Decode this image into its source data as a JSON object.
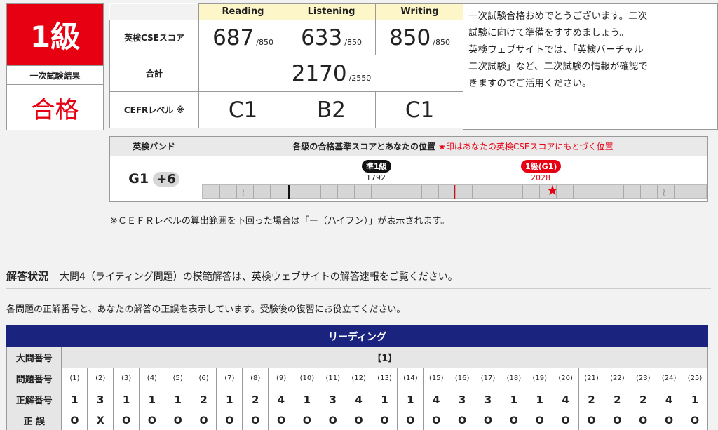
{
  "grade": {
    "level": "1級",
    "result_label": "一次試験結果",
    "result": "合格"
  },
  "scores": {
    "skills": [
      "Reading",
      "Listening",
      "Writing"
    ],
    "cse_label": "英検CSEスコア",
    "cse_values": [
      "687",
      "633",
      "850"
    ],
    "cse_max": [
      "/850",
      "/850",
      "/850"
    ],
    "total_label": "合計",
    "total_value": "2170",
    "total_max": "/2550",
    "cefr_label": "CEFRレベル ※",
    "cefr_values": [
      "C1",
      "B2",
      "C1"
    ]
  },
  "message": {
    "lines": [
      "一次試験合格おめでとうございます。二次",
      "試験に向けて準備をすすめましょう。",
      "英検ウェブサイトでは、「英検バーチャル",
      "二次試験」など、二次試験の情報が確認で",
      "きますのでご活用ください。"
    ]
  },
  "band": {
    "header_label": "英検バンド",
    "header_title": "各級の合格基準スコアとあなたの位置",
    "header_note": "★印はあなたの英検CSEスコアにもとづく位置",
    "value": "G1",
    "plus": "+6",
    "markers": [
      {
        "label": "準1級",
        "score": "1792"
      },
      {
        "label": "1級(G1)",
        "score": "2028"
      }
    ]
  },
  "cefr_note": "※ＣＥＦＲレベルの算出範囲を下回った場合は「ー（ハイフン）」が表示されます。",
  "answers_section": {
    "title": "解答状況",
    "subtitle": "大問4（ライティング問題）の模範解答は、英検ウェブサイトの解答速報をご覧ください。",
    "description": "各問題の正解番号と、あなたの解答の正誤を表示しています。受験後の復習にお役立てください。"
  },
  "reading_grid": {
    "banner": "リーディング",
    "row_labels": [
      "大問番号",
      "問題番号",
      "正解番号",
      "正 誤"
    ],
    "section": "【1】",
    "questions": [
      "(1)",
      "(2)",
      "(3)",
      "(4)",
      "(5)",
      "(6)",
      "(7)",
      "(8)",
      "(9)",
      "(10)",
      "(11)",
      "(12)",
      "(13)",
      "(14)",
      "(15)",
      "(16)",
      "(17)",
      "(18)",
      "(19)",
      "(20)",
      "(21)",
      "(22)",
      "(23)",
      "(24)",
      "(25)"
    ],
    "answers": [
      "1",
      "3",
      "1",
      "1",
      "1",
      "2",
      "1",
      "2",
      "4",
      "1",
      "3",
      "4",
      "1",
      "1",
      "4",
      "3",
      "3",
      "1",
      "1",
      "4",
      "2",
      "2",
      "2",
      "4",
      "1"
    ],
    "marks": [
      "O",
      "X",
      "O",
      "O",
      "O",
      "O",
      "O",
      "O",
      "O",
      "O",
      "O",
      "O",
      "O",
      "O",
      "O",
      "O",
      "O",
      "O",
      "O",
      "O",
      "O",
      "O",
      "O",
      "O",
      "O"
    ]
  }
}
